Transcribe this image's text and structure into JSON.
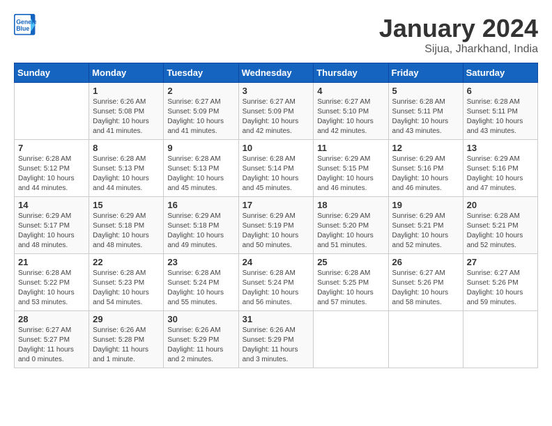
{
  "logo": {
    "line1": "General",
    "line2": "Blue"
  },
  "title": "January 2024",
  "subtitle": "Sijua, Jharkhand, India",
  "headers": [
    "Sunday",
    "Monday",
    "Tuesday",
    "Wednesday",
    "Thursday",
    "Friday",
    "Saturday"
  ],
  "weeks": [
    [
      {
        "day": "",
        "sunrise": "",
        "sunset": "",
        "daylight": ""
      },
      {
        "day": "1",
        "sunrise": "Sunrise: 6:26 AM",
        "sunset": "Sunset: 5:08 PM",
        "daylight": "Daylight: 10 hours and 41 minutes."
      },
      {
        "day": "2",
        "sunrise": "Sunrise: 6:27 AM",
        "sunset": "Sunset: 5:09 PM",
        "daylight": "Daylight: 10 hours and 41 minutes."
      },
      {
        "day": "3",
        "sunrise": "Sunrise: 6:27 AM",
        "sunset": "Sunset: 5:09 PM",
        "daylight": "Daylight: 10 hours and 42 minutes."
      },
      {
        "day": "4",
        "sunrise": "Sunrise: 6:27 AM",
        "sunset": "Sunset: 5:10 PM",
        "daylight": "Daylight: 10 hours and 42 minutes."
      },
      {
        "day": "5",
        "sunrise": "Sunrise: 6:28 AM",
        "sunset": "Sunset: 5:11 PM",
        "daylight": "Daylight: 10 hours and 43 minutes."
      },
      {
        "day": "6",
        "sunrise": "Sunrise: 6:28 AM",
        "sunset": "Sunset: 5:11 PM",
        "daylight": "Daylight: 10 hours and 43 minutes."
      }
    ],
    [
      {
        "day": "7",
        "sunrise": "Sunrise: 6:28 AM",
        "sunset": "Sunset: 5:12 PM",
        "daylight": "Daylight: 10 hours and 44 minutes."
      },
      {
        "day": "8",
        "sunrise": "Sunrise: 6:28 AM",
        "sunset": "Sunset: 5:13 PM",
        "daylight": "Daylight: 10 hours and 44 minutes."
      },
      {
        "day": "9",
        "sunrise": "Sunrise: 6:28 AM",
        "sunset": "Sunset: 5:13 PM",
        "daylight": "Daylight: 10 hours and 45 minutes."
      },
      {
        "day": "10",
        "sunrise": "Sunrise: 6:28 AM",
        "sunset": "Sunset: 5:14 PM",
        "daylight": "Daylight: 10 hours and 45 minutes."
      },
      {
        "day": "11",
        "sunrise": "Sunrise: 6:29 AM",
        "sunset": "Sunset: 5:15 PM",
        "daylight": "Daylight: 10 hours and 46 minutes."
      },
      {
        "day": "12",
        "sunrise": "Sunrise: 6:29 AM",
        "sunset": "Sunset: 5:16 PM",
        "daylight": "Daylight: 10 hours and 46 minutes."
      },
      {
        "day": "13",
        "sunrise": "Sunrise: 6:29 AM",
        "sunset": "Sunset: 5:16 PM",
        "daylight": "Daylight: 10 hours and 47 minutes."
      }
    ],
    [
      {
        "day": "14",
        "sunrise": "Sunrise: 6:29 AM",
        "sunset": "Sunset: 5:17 PM",
        "daylight": "Daylight: 10 hours and 48 minutes."
      },
      {
        "day": "15",
        "sunrise": "Sunrise: 6:29 AM",
        "sunset": "Sunset: 5:18 PM",
        "daylight": "Daylight: 10 hours and 48 minutes."
      },
      {
        "day": "16",
        "sunrise": "Sunrise: 6:29 AM",
        "sunset": "Sunset: 5:18 PM",
        "daylight": "Daylight: 10 hours and 49 minutes."
      },
      {
        "day": "17",
        "sunrise": "Sunrise: 6:29 AM",
        "sunset": "Sunset: 5:19 PM",
        "daylight": "Daylight: 10 hours and 50 minutes."
      },
      {
        "day": "18",
        "sunrise": "Sunrise: 6:29 AM",
        "sunset": "Sunset: 5:20 PM",
        "daylight": "Daylight: 10 hours and 51 minutes."
      },
      {
        "day": "19",
        "sunrise": "Sunrise: 6:29 AM",
        "sunset": "Sunset: 5:21 PM",
        "daylight": "Daylight: 10 hours and 52 minutes."
      },
      {
        "day": "20",
        "sunrise": "Sunrise: 6:28 AM",
        "sunset": "Sunset: 5:21 PM",
        "daylight": "Daylight: 10 hours and 52 minutes."
      }
    ],
    [
      {
        "day": "21",
        "sunrise": "Sunrise: 6:28 AM",
        "sunset": "Sunset: 5:22 PM",
        "daylight": "Daylight: 10 hours and 53 minutes."
      },
      {
        "day": "22",
        "sunrise": "Sunrise: 6:28 AM",
        "sunset": "Sunset: 5:23 PM",
        "daylight": "Daylight: 10 hours and 54 minutes."
      },
      {
        "day": "23",
        "sunrise": "Sunrise: 6:28 AM",
        "sunset": "Sunset: 5:24 PM",
        "daylight": "Daylight: 10 hours and 55 minutes."
      },
      {
        "day": "24",
        "sunrise": "Sunrise: 6:28 AM",
        "sunset": "Sunset: 5:24 PM",
        "daylight": "Daylight: 10 hours and 56 minutes."
      },
      {
        "day": "25",
        "sunrise": "Sunrise: 6:28 AM",
        "sunset": "Sunset: 5:25 PM",
        "daylight": "Daylight: 10 hours and 57 minutes."
      },
      {
        "day": "26",
        "sunrise": "Sunrise: 6:27 AM",
        "sunset": "Sunset: 5:26 PM",
        "daylight": "Daylight: 10 hours and 58 minutes."
      },
      {
        "day": "27",
        "sunrise": "Sunrise: 6:27 AM",
        "sunset": "Sunset: 5:26 PM",
        "daylight": "Daylight: 10 hours and 59 minutes."
      }
    ],
    [
      {
        "day": "28",
        "sunrise": "Sunrise: 6:27 AM",
        "sunset": "Sunset: 5:27 PM",
        "daylight": "Daylight: 11 hours and 0 minutes."
      },
      {
        "day": "29",
        "sunrise": "Sunrise: 6:26 AM",
        "sunset": "Sunset: 5:28 PM",
        "daylight": "Daylight: 11 hours and 1 minute."
      },
      {
        "day": "30",
        "sunrise": "Sunrise: 6:26 AM",
        "sunset": "Sunset: 5:29 PM",
        "daylight": "Daylight: 11 hours and 2 minutes."
      },
      {
        "day": "31",
        "sunrise": "Sunrise: 6:26 AM",
        "sunset": "Sunset: 5:29 PM",
        "daylight": "Daylight: 11 hours and 3 minutes."
      },
      {
        "day": "",
        "sunrise": "",
        "sunset": "",
        "daylight": ""
      },
      {
        "day": "",
        "sunrise": "",
        "sunset": "",
        "daylight": ""
      },
      {
        "day": "",
        "sunrise": "",
        "sunset": "",
        "daylight": ""
      }
    ]
  ]
}
